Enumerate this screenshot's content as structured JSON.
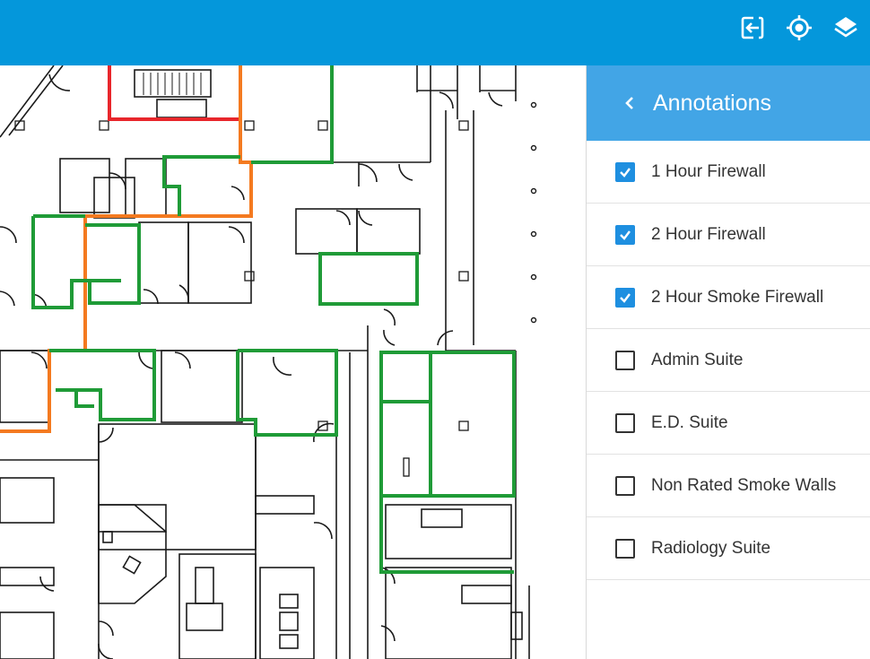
{
  "topbar": {
    "color": "#0497db",
    "icons": [
      "exit-icon",
      "locate-icon",
      "layers-icon"
    ]
  },
  "panel": {
    "title": "Annotations",
    "back_icon": "chevron-left-icon",
    "header_color": "#42a5e6",
    "items": [
      {
        "label": "1 Hour Firewall",
        "checked": true
      },
      {
        "label": "2 Hour Firewall",
        "checked": true
      },
      {
        "label": "2 Hour Smoke Firewall",
        "checked": true
      },
      {
        "label": "Admin Suite",
        "checked": false
      },
      {
        "label": "E.D. Suite",
        "checked": false
      },
      {
        "label": "Non Rated Smoke Walls",
        "checked": false
      },
      {
        "label": "Radiology Suite",
        "checked": false
      }
    ]
  },
  "map": {
    "line_colors": {
      "one_hour": "#e8262b",
      "two_hour": "#f47a20",
      "smoke": "#1f9b37",
      "walls": "#1a1a1a"
    }
  }
}
